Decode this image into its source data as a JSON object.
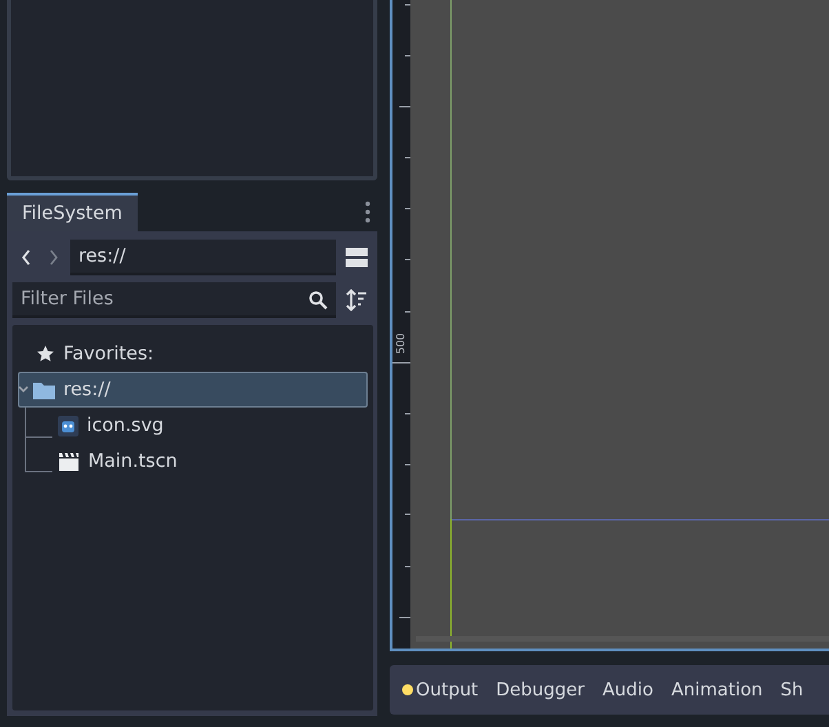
{
  "filesystem_dock": {
    "tab": {
      "label": "FileSystem",
      "selected": true
    },
    "path": "res://",
    "filter": {
      "placeholder": "Filter Files"
    },
    "tree": [
      {
        "kind": "favorites",
        "label": "Favorites:"
      },
      {
        "kind": "folder",
        "label": "res://",
        "selected": true,
        "expanded": true,
        "children": [
          {
            "kind": "image",
            "label": "icon.svg",
            "selected": false
          },
          {
            "kind": "scene",
            "label": "Main.tscn",
            "selected": false
          }
        ]
      }
    ]
  },
  "viewport": {
    "ruler_label": "500"
  },
  "bottom_tabs": [
    {
      "label": "Output",
      "notification": true
    },
    {
      "label": "Debugger",
      "notification": false
    },
    {
      "label": "Audio",
      "notification": false
    },
    {
      "label": "Animation",
      "notification": false
    },
    {
      "label": "Sh",
      "notification": false
    }
  ]
}
